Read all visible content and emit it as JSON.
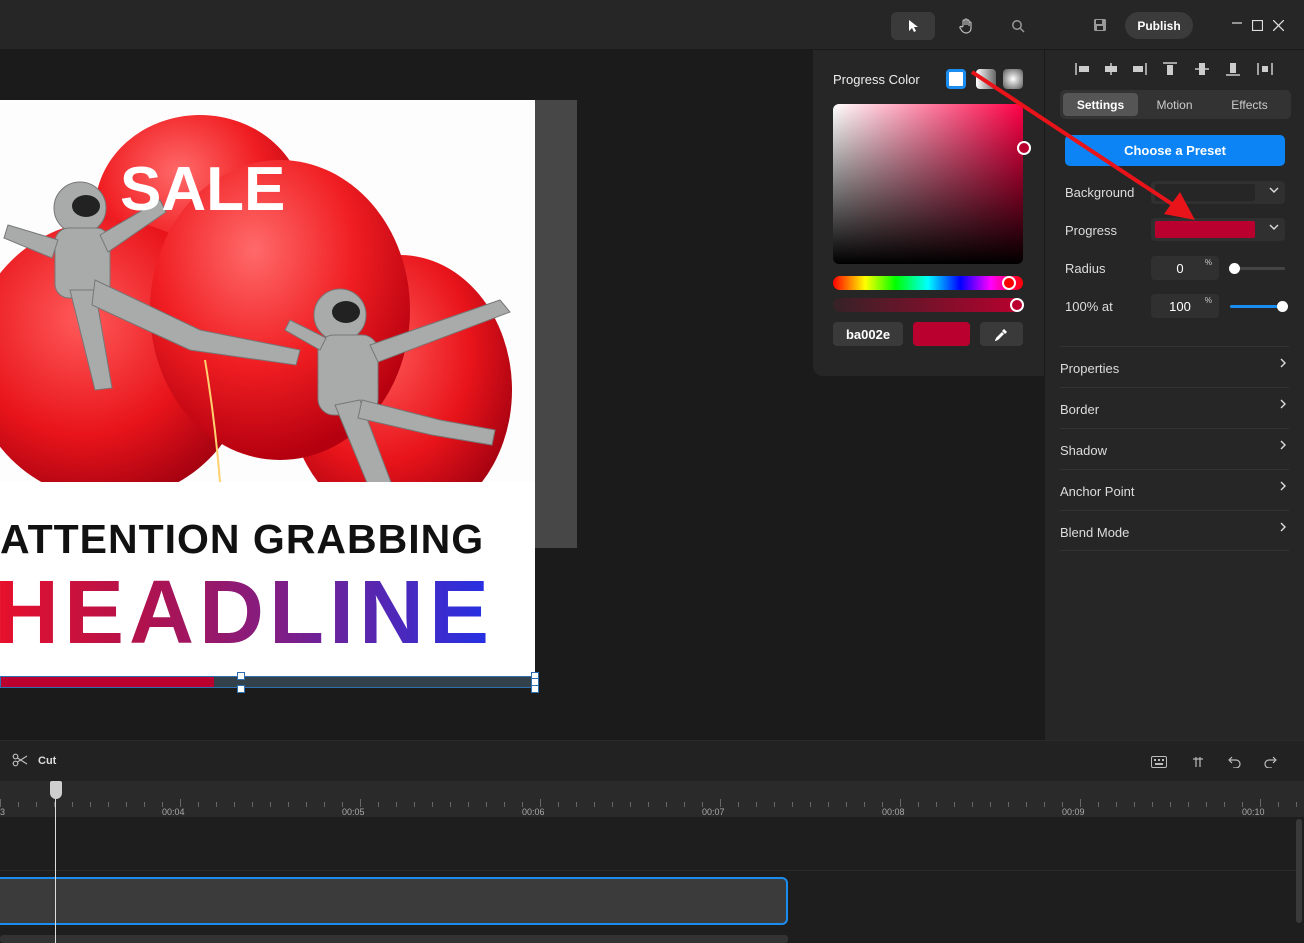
{
  "toolbar": {
    "tools": [
      {
        "name": "select",
        "icon": "pointer-arrow-icon",
        "active": true
      },
      {
        "name": "hand",
        "icon": "hand-icon",
        "active": false
      },
      {
        "name": "zoom",
        "icon": "magnifier-icon",
        "active": false
      }
    ],
    "save_icon": "save-icon",
    "publish_label": "Publish",
    "window_controls": [
      "minimize-icon",
      "maximize-icon",
      "close-icon"
    ]
  },
  "artboard": {
    "headline_top": "ATTENTION GRABBING",
    "headline_main": "HEADLINE",
    "balloon_text": "SALE",
    "progress_fill_fraction": 0.4
  },
  "color_picker": {
    "title": "Progress Color",
    "modes": [
      "solid",
      "linear-gradient",
      "radial-gradient"
    ],
    "hex_value": "ba002e",
    "current_color": "#ba002e",
    "eyedropper_icon": "eyedropper-icon"
  },
  "settings_panel": {
    "align_icons": [
      "align-left-icon",
      "align-center-horizontal-icon",
      "align-right-icon",
      "align-top-icon",
      "align-center-vertical-icon",
      "align-bottom-icon",
      "distribute-icon"
    ],
    "tabs": [
      "Settings",
      "Motion",
      "Effects"
    ],
    "active_tab": "Settings",
    "preset_button": "Choose a Preset",
    "background_label": "Background",
    "background_color": "#262626",
    "progress_label": "Progress",
    "progress_color": "#ba002e",
    "radius_label": "Radius",
    "radius_value": "0",
    "radius_unit": "%",
    "at100_label": "100% at",
    "at100_value": "100",
    "at100_unit": "%",
    "sections": [
      "Properties",
      "Border",
      "Shadow",
      "Anchor Point",
      "Blend Mode"
    ]
  },
  "timeline": {
    "cut_label": "Cut",
    "cut_icon": "scissors-icon",
    "right_icons": [
      "keyboard-icon",
      "split-icon",
      "undo-icon",
      "redo-icon"
    ],
    "ruler_labels": [
      "3",
      "00:04",
      "00:05",
      "00:06",
      "00:07",
      "00:08",
      "00:09",
      "00:10"
    ]
  },
  "accent_colors": {
    "primary_blue": "#0d84f5",
    "annotation_arrow": "#e8141a"
  }
}
